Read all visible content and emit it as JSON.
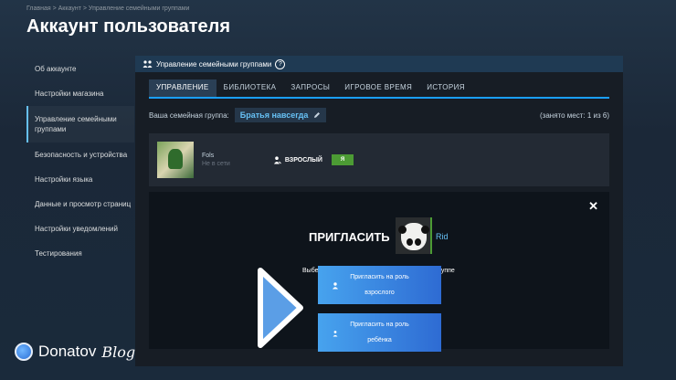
{
  "breadcrumb": "Главная > Аккаунт > Управление семейными группами",
  "page_title": "Аккаунт пользователя",
  "sidebar": {
    "items": [
      {
        "label": "Об аккаунте"
      },
      {
        "label": "Настройки магазина"
      },
      {
        "label": "Управление семейными группами",
        "active": true
      },
      {
        "label": "Безопасность и устройства"
      },
      {
        "label": "Настройки языка"
      },
      {
        "label": "Данные и просмотр страниц"
      },
      {
        "label": "Настройки уведомлений"
      },
      {
        "label": "Тестирования"
      }
    ]
  },
  "main": {
    "section_title": "Управление семейными группами",
    "help": "?",
    "tabs": [
      {
        "label": "УПРАВЛЕНИЕ",
        "active": true
      },
      {
        "label": "БИБЛИОТЕКА"
      },
      {
        "label": "ЗАПРОСЫ"
      },
      {
        "label": "ИГРОВОЕ ВРЕМЯ"
      },
      {
        "label": "ИСТОРИЯ"
      }
    ],
    "group_label": "Ваша семейная группа:",
    "group_name": "Братья навсегда",
    "slots": "(занято мест: 1 из 6)",
    "member": {
      "name": "Fols",
      "status": "Не в сети",
      "role": "ВЗРОСЛЫЙ",
      "badge": "Я"
    },
    "invite": {
      "title": "ПРИГЛАСИТЬ",
      "invitee": "Rid",
      "choose_left": "Выбе",
      "choose_right": "руппе",
      "adult_line1": "Пригласить на роль",
      "adult_line2": "взрослого",
      "child_line1": "Пригласить на роль",
      "child_line2": "ребёнка",
      "close": "✕"
    }
  },
  "watermark": {
    "brand": "Donatov",
    "blog": "Blog"
  },
  "colors": {
    "accent": "#66c0f4",
    "tab_underline": "#1a9fff",
    "badge_green": "#4c9b34",
    "button_gradient": [
      "#47a3ee",
      "#2e6bd3"
    ]
  }
}
